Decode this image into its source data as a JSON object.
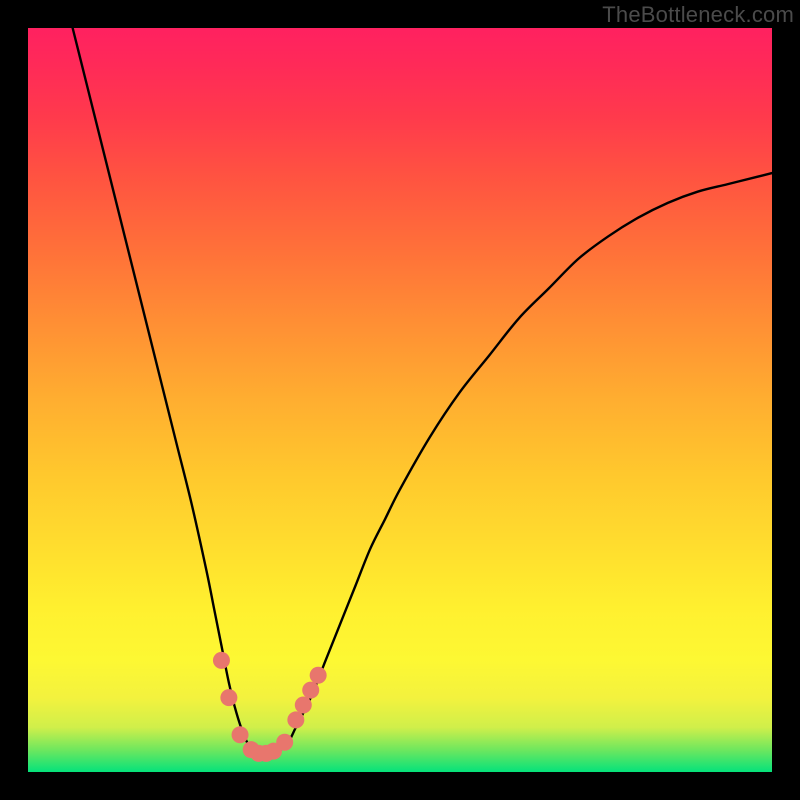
{
  "watermark": "TheBottleneck.com",
  "chart_data": {
    "type": "line",
    "title": "",
    "xlabel": "",
    "ylabel": "",
    "xlim": [
      0,
      100
    ],
    "ylim": [
      0,
      100
    ],
    "series": [
      {
        "name": "curve",
        "x": [
          6,
          8,
          10,
          12,
          14,
          16,
          18,
          20,
          22,
          24,
          25,
          26,
          27,
          28,
          29,
          30,
          31,
          32,
          33,
          34,
          35,
          36,
          38,
          40,
          42,
          44,
          46,
          48,
          50,
          54,
          58,
          62,
          66,
          70,
          74,
          78,
          82,
          86,
          90,
          94,
          98,
          100
        ],
        "y": [
          100,
          92,
          84,
          76,
          68,
          60,
          52,
          44,
          36,
          27,
          22,
          17,
          12,
          8,
          5,
          3,
          2,
          2,
          2,
          3,
          4,
          6,
          10,
          15,
          20,
          25,
          30,
          34,
          38,
          45,
          51,
          56,
          61,
          65,
          69,
          72,
          74.5,
          76.5,
          78,
          79,
          80,
          80.5
        ]
      }
    ],
    "markers": [
      {
        "x": 26,
        "y": 15
      },
      {
        "x": 27,
        "y": 10
      },
      {
        "x": 28.5,
        "y": 5
      },
      {
        "x": 30,
        "y": 3
      },
      {
        "x": 31,
        "y": 2.5
      },
      {
        "x": 32,
        "y": 2.5
      },
      {
        "x": 33,
        "y": 2.8
      },
      {
        "x": 34.5,
        "y": 4
      },
      {
        "x": 36,
        "y": 7
      },
      {
        "x": 37,
        "y": 9
      },
      {
        "x": 38,
        "y": 11
      },
      {
        "x": 39,
        "y": 13
      }
    ],
    "marker_color": "#e8766d",
    "curve_color": "#000000"
  }
}
